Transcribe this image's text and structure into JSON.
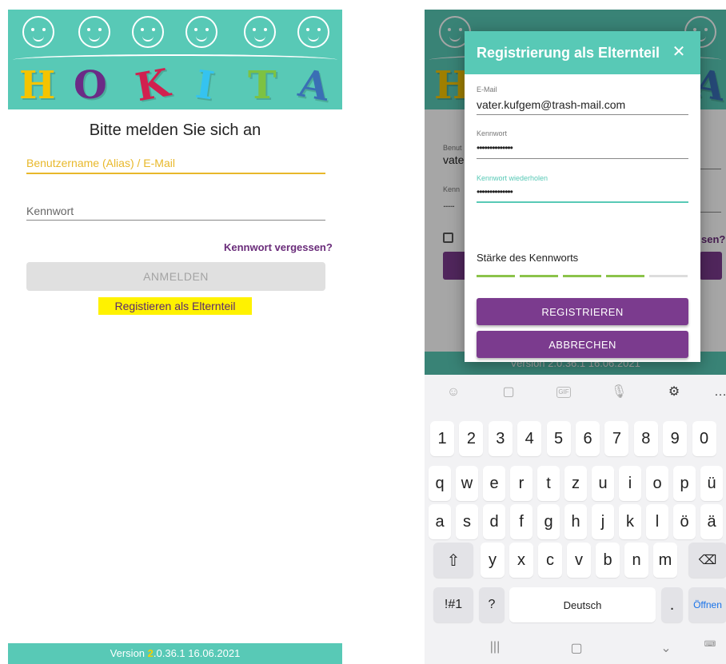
{
  "left": {
    "logo_letters": [
      "H",
      "O",
      "K",
      "I",
      "T",
      "A"
    ],
    "title": "Bitte melden Sie sich an",
    "username_placeholder": "Benutzername (Alias) / E-Mail",
    "password_placeholder": "Kennwort",
    "forgot_link": "Kennwort vergessen?",
    "login_button": "ANMELDEN",
    "register_link": "Registieren als Elternteil",
    "footer_version_prefix": "Version ",
    "footer_version_digit": "2",
    "footer_version_rest": ".0.36.1 16.06.2021"
  },
  "right": {
    "behind": {
      "username_label": "Benut",
      "username_value": "vate",
      "password_label": "Kenn",
      "password_value": "......",
      "forgot_fragment": "sen?",
      "footer": "Version  2.0.36.1 16.06.2021"
    },
    "dialog": {
      "title": "Registrierung als Elternteil",
      "close_icon": "close-icon",
      "email_label": "E-Mail",
      "email_value": "vater.kufgem@trash-mail.com",
      "password_label": "Kennwort",
      "password_value": "••••••••••••••",
      "password_repeat_label": "Kennwort wiederholen",
      "password_repeat_value": "••••••••••••••",
      "strength_label": "Stärke des Kennworts",
      "strength_level": 0.8,
      "register_button": "REGISTRIEREN",
      "cancel_button": "ABBRECHEN"
    },
    "keyboard": {
      "suggestion_icons": [
        "emoji-icon",
        "sticker-icon",
        "gif-icon",
        "mic-icon",
        "gear-icon",
        "more-icon"
      ],
      "gif_label": "GIF",
      "row_numbers": [
        "1",
        "2",
        "3",
        "4",
        "5",
        "6",
        "7",
        "8",
        "9",
        "0"
      ],
      "row_1": [
        "q",
        "w",
        "e",
        "r",
        "t",
        "z",
        "u",
        "i",
        "o",
        "p",
        "ü"
      ],
      "row_2": [
        "a",
        "s",
        "d",
        "f",
        "g",
        "h",
        "j",
        "k",
        "l",
        "ö",
        "ä"
      ],
      "row_3": [
        "y",
        "x",
        "c",
        "v",
        "b",
        "n",
        "m"
      ],
      "symbols_key": "!#1",
      "question_key": "?",
      "space_key": "Deutsch",
      "period_key": ".",
      "action_key": "Öffnen"
    },
    "colors": {
      "teal": "#58c9b6",
      "purple": "#7b3b8e",
      "highlight": "#fff200",
      "strength_green": "#8bc34a"
    }
  }
}
